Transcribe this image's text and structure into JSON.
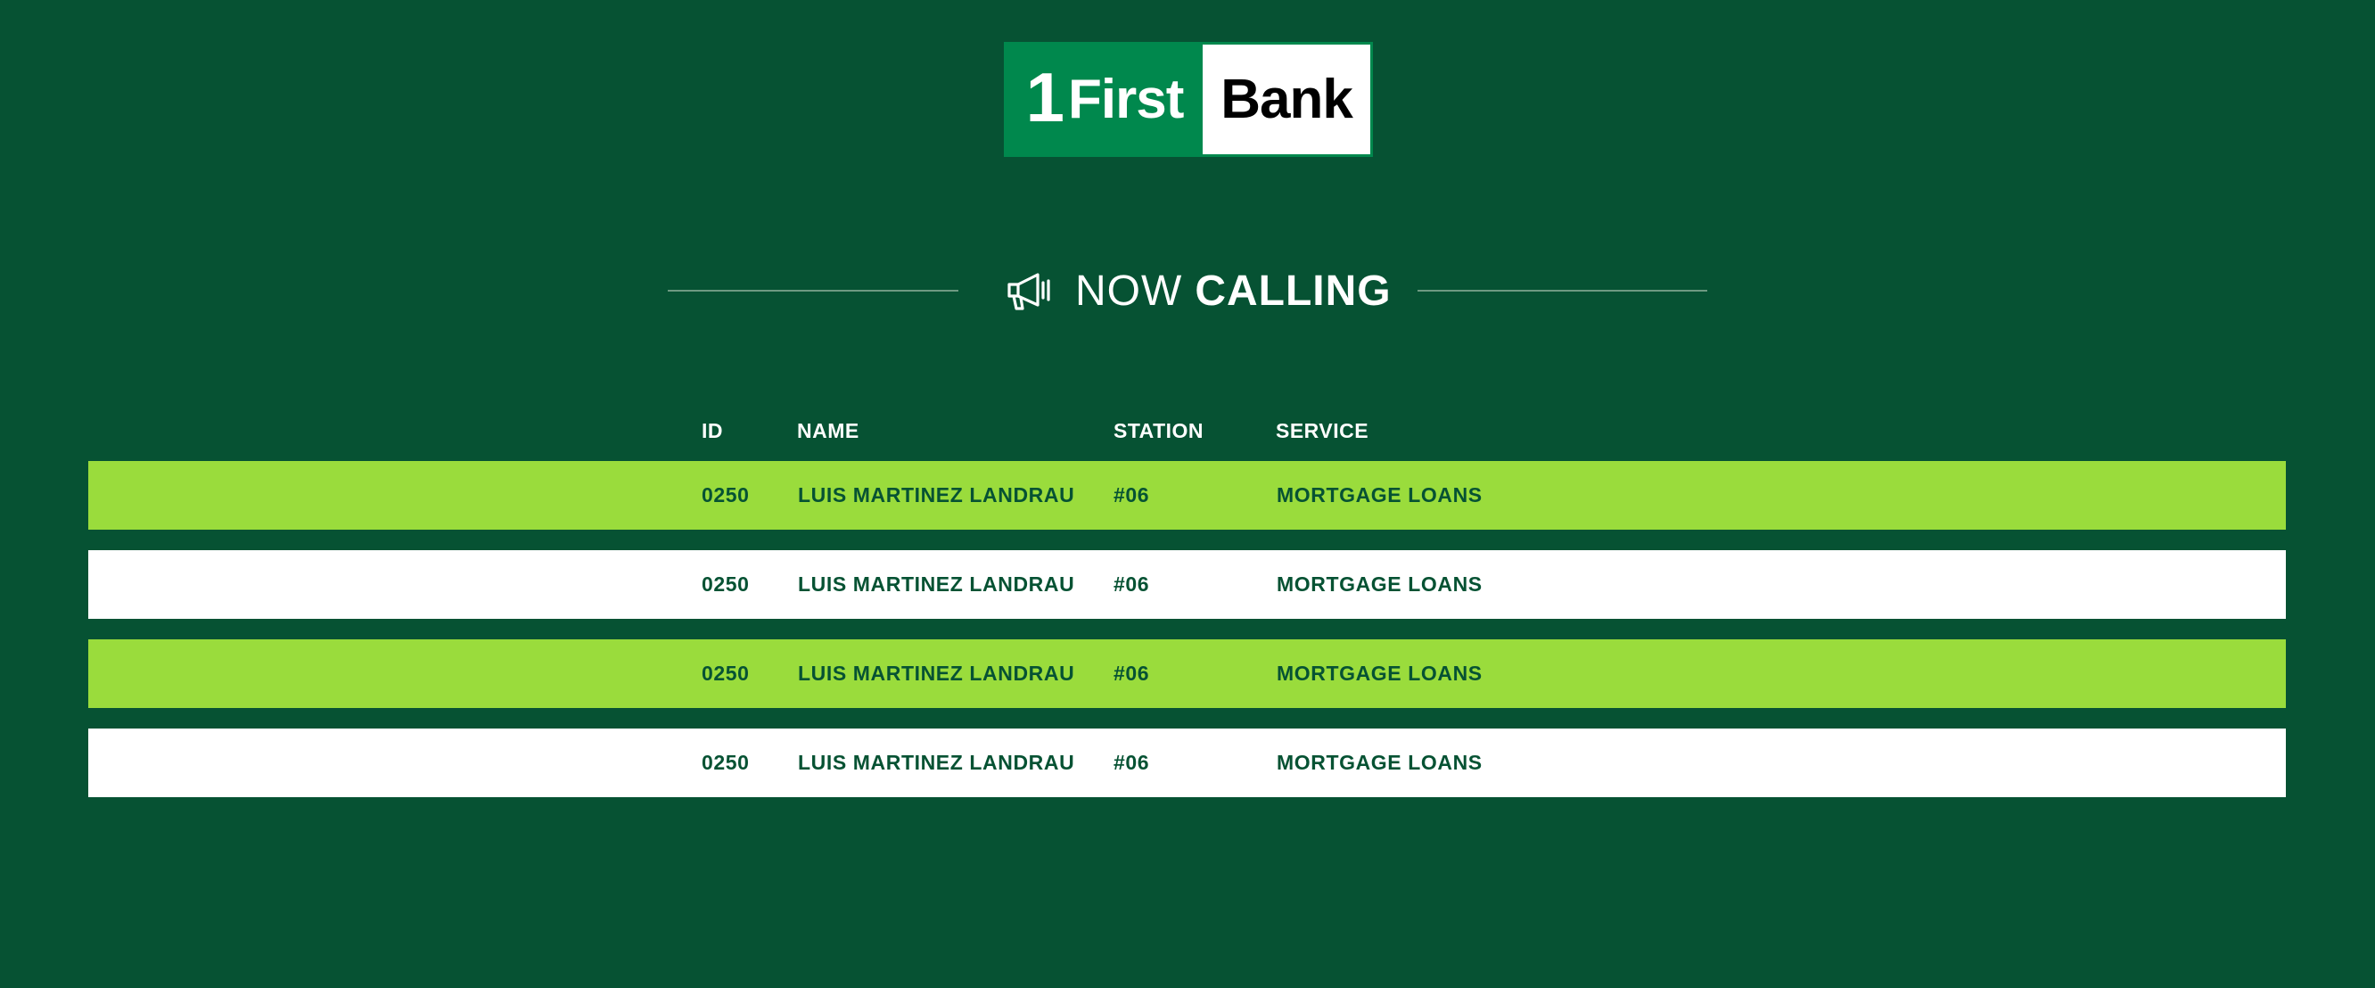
{
  "brand": {
    "logo_number": "1",
    "logo_first": "First",
    "logo_bank": "Bank",
    "colors": {
      "background": "#065233",
      "logo_green": "#00884d",
      "row_highlight": "#9adc3c",
      "row_plain": "#ffffff",
      "row_text": "#065233"
    }
  },
  "heading": {
    "icon": "megaphone-icon",
    "light": "NOW",
    "bold": "CALLING"
  },
  "table": {
    "headers": {
      "id": "ID",
      "name": "NAME",
      "station": "STATION",
      "service": "SERVICE"
    },
    "rows": [
      {
        "id": "0250",
        "name": "LUIS MARTINEZ LANDRAU",
        "station": "#06",
        "service": "MORTGAGE LOANS",
        "style": "green"
      },
      {
        "id": "0250",
        "name": "LUIS MARTINEZ LANDRAU",
        "station": "#06",
        "service": "MORTGAGE LOANS",
        "style": "white"
      },
      {
        "id": "0250",
        "name": "LUIS MARTINEZ LANDRAU",
        "station": "#06",
        "service": "MORTGAGE LOANS",
        "style": "green"
      },
      {
        "id": "0250",
        "name": "LUIS MARTINEZ LANDRAU",
        "station": "#06",
        "service": "MORTGAGE LOANS",
        "style": "white"
      }
    ]
  }
}
